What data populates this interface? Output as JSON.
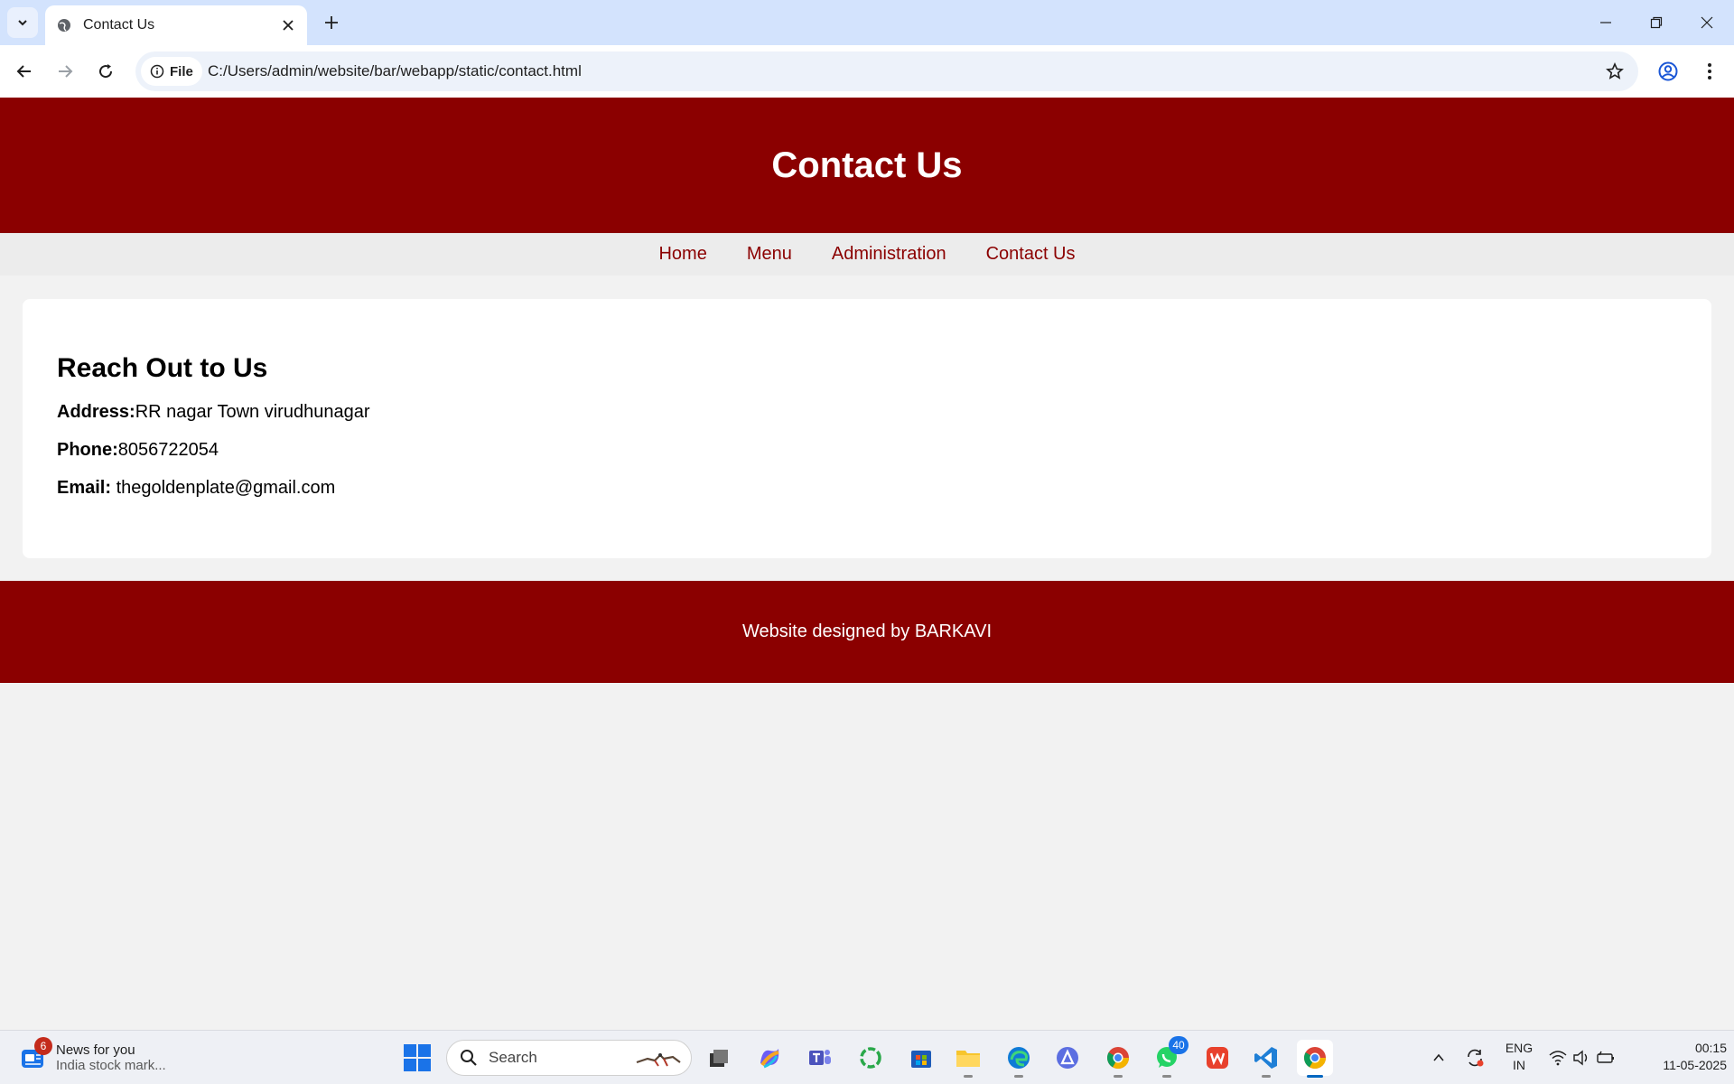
{
  "browser": {
    "tab_title": "Contact Us",
    "site_chip": "File",
    "url": "C:/Users/admin/website/bar/webapp/static/contact.html"
  },
  "page": {
    "header_title": "Contact Us",
    "nav": [
      "Home",
      "Menu",
      "Administration",
      "Contact Us"
    ],
    "section_title": "Reach Out to Us",
    "address_label": "Address:",
    "address_value": "RR nagar Town virudhunagar",
    "phone_label": "Phone:",
    "phone_value": "8056722054",
    "email_label": "Email:",
    "email_value": " thegoldenplate@gmail.com",
    "footer_text": "Website designed by BARKAVI",
    "colors": {
      "brand": "#8b0000",
      "nav_bg": "#ececec",
      "page_bg": "#f2f2f2"
    }
  },
  "taskbar": {
    "news_badge": "6",
    "news_title": "News for you",
    "news_subtitle": "India stock mark...",
    "search_label": "Search",
    "whatsapp_badge": "40",
    "lang_line1": "ENG",
    "lang_line2": "IN",
    "time": "00:15",
    "date": "11-05-2025"
  }
}
